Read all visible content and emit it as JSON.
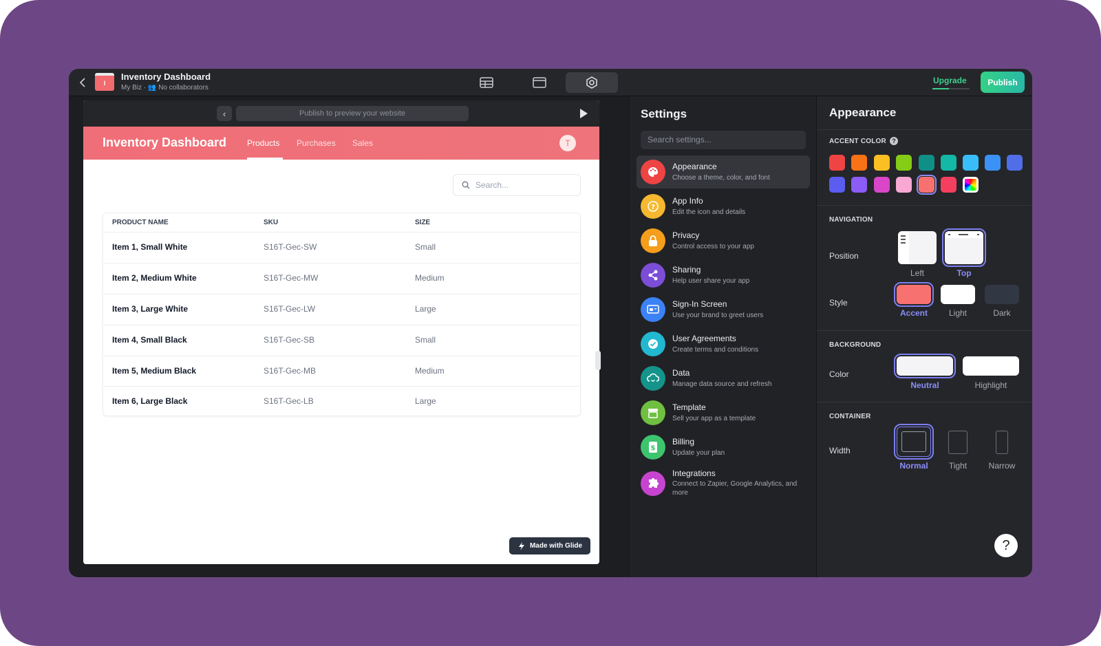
{
  "topbar": {
    "app_title": "Inventory Dashboard",
    "app_subtitle": "My Biz · 👥 No collaborators",
    "app_thumb_letter": "I",
    "upgrade_label": "Upgrade",
    "publish_label": "Publish",
    "icons": [
      "table-icon",
      "layout-icon",
      "settings-icon"
    ],
    "active_icon": "settings-icon"
  },
  "preview": {
    "url_placeholder": "Publish to preview your website",
    "header_title": "Inventory Dashboard",
    "tabs": [
      {
        "label": "Products",
        "active": true
      },
      {
        "label": "Purchases",
        "active": false
      },
      {
        "label": "Sales",
        "active": false
      }
    ],
    "avatar_letter": "T",
    "search_placeholder": "Search...",
    "columns": [
      "PRODUCT NAME",
      "SKU",
      "SIZE"
    ],
    "rows": [
      {
        "name": "Item 1, Small White",
        "sku": "S16T-Gec-SW",
        "size": "Small"
      },
      {
        "name": "Item 2, Medium White",
        "sku": "S16T-Gec-MW",
        "size": "Medium"
      },
      {
        "name": "Item 3, Large White",
        "sku": "S16T-Gec-LW",
        "size": "Large"
      },
      {
        "name": "Item 4, Small Black",
        "sku": "S16T-Gec-SB",
        "size": "Small"
      },
      {
        "name": "Item 5, Medium Black",
        "sku": "S16T-Gec-MB",
        "size": "Medium"
      },
      {
        "name": "Item 6, Large Black",
        "sku": "S16T-Gec-LB",
        "size": "Large"
      }
    ],
    "made_with_label": "Made with Glide",
    "accent_color": "#f06e78"
  },
  "settings": {
    "title": "Settings",
    "search_placeholder": "Search settings...",
    "items": [
      {
        "title": "Appearance",
        "desc": "Choose a theme, color, and font",
        "icon": "palette-icon",
        "color": "#ef4444",
        "active": true
      },
      {
        "title": "App Info",
        "desc": "Edit the icon and details",
        "icon": "info-icon",
        "color": "#f5b82e",
        "active": false
      },
      {
        "title": "Privacy",
        "desc": "Control access to your app",
        "icon": "lock-icon",
        "color": "#f59e1b",
        "active": false
      },
      {
        "title": "Sharing",
        "desc": "Help user share your app",
        "icon": "share-icon",
        "color": "#7c4dd6",
        "active": false
      },
      {
        "title": "Sign-In Screen",
        "desc": "Use your brand to greet users",
        "icon": "sign-in-icon",
        "color": "#3b82f6",
        "active": false
      },
      {
        "title": "User Agreements",
        "desc": "Create terms and conditions",
        "icon": "check-icon",
        "color": "#22b8cf",
        "active": false
      },
      {
        "title": "Data",
        "desc": "Manage data source and refresh",
        "icon": "data-icon",
        "color": "#14948a",
        "active": false
      },
      {
        "title": "Template",
        "desc": "Sell your app as a template",
        "icon": "store-icon",
        "color": "#6fbf40",
        "active": false
      },
      {
        "title": "Billing",
        "desc": "Update your plan",
        "icon": "billing-icon",
        "color": "#3cc46e",
        "active": false
      },
      {
        "title": "Integrations",
        "desc": "Connect to Zapier, Google Analytics, and more",
        "icon": "puzzle-icon",
        "color": "#c744d0",
        "active": false
      }
    ]
  },
  "appearance": {
    "title": "Appearance",
    "accent_label": "ACCENT COLOR",
    "accent_colors": [
      "#ef4444",
      "#f97316",
      "#fbbf24",
      "#84cc16",
      "#0f8f86",
      "#14b8a6",
      "#38bdf8",
      "#3b92f6",
      "#4f6ee8",
      "#5b5cf0",
      "#8b5cf6",
      "#d946c8",
      "#f9a8d4",
      "#f87171",
      "#f43f5e",
      "rainbow"
    ],
    "accent_selected_index": 13,
    "navigation_label": "NAVIGATION",
    "position_label": "Position",
    "position_options": [
      "Left",
      "Top"
    ],
    "position_selected": "Top",
    "style_label": "Style",
    "style_options": [
      "Accent",
      "Light",
      "Dark"
    ],
    "style_selected": "Accent",
    "background_label": "BACKGROUND",
    "color_label": "Color",
    "color_options": [
      "Neutral",
      "Highlight"
    ],
    "color_selected": "Neutral",
    "container_label": "CONTAINER",
    "width_label": "Width",
    "width_options": [
      "Normal",
      "Tight",
      "Narrow"
    ],
    "width_selected": "Normal",
    "help_label": "?"
  }
}
